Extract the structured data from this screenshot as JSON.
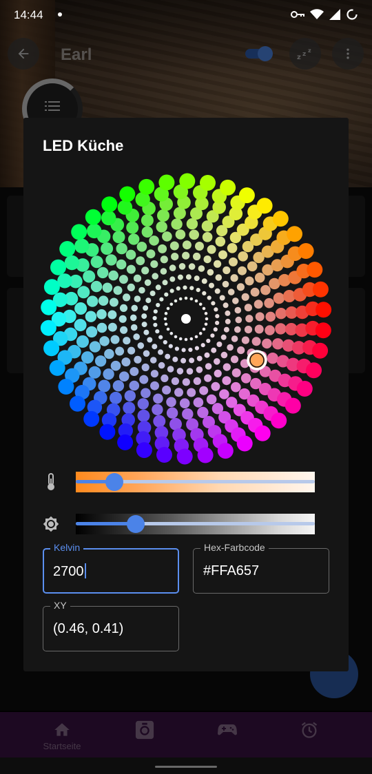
{
  "status_bar": {
    "time": "14:44"
  },
  "background": {
    "title": "Earl",
    "nav": [
      {
        "label": "Startseite",
        "icon": "home-icon"
      },
      {
        "label": "",
        "icon": "photo-frame-icon"
      },
      {
        "label": "",
        "icon": "gamepad-icon"
      },
      {
        "label": "",
        "icon": "alarm-icon"
      }
    ],
    "toggle_on": true
  },
  "dialog": {
    "title": "LED Küche",
    "color_wheel": {
      "selected_color": "#FFA657",
      "rings": 12
    },
    "temperature_slider": {
      "icon": "thermometer-icon",
      "value_fraction": 0.16
    },
    "brightness_slider": {
      "icon": "brightness-icon",
      "value_fraction": 0.25
    },
    "fields": {
      "kelvin": {
        "label": "Kelvin",
        "value": "2700"
      },
      "hex": {
        "label": "Hex-Farbcode",
        "value": "#FFA657"
      },
      "xy": {
        "label": "XY",
        "value": "(0.46, 0.41)"
      }
    }
  },
  "colors": {
    "accent": "#4B83E8",
    "dialog_bg": "#151515",
    "nav_bg": "#3A1244"
  }
}
